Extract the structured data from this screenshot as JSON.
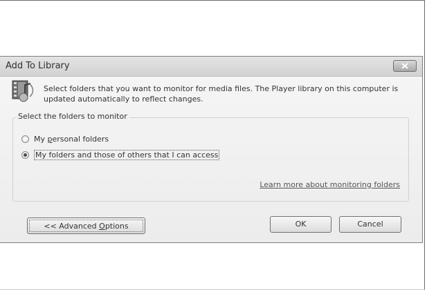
{
  "dialog": {
    "title": "Add To Library",
    "description": "Select folders that you want to monitor for media files. The Player library on this computer is updated automatically to reflect changes.",
    "group_title": "Select the folders to monitor",
    "options": [
      {
        "pre": "My ",
        "access": "p",
        "post": "ersonal folders",
        "checked": false
      },
      {
        "pre": "My folders and those of others that I can access",
        "access": "",
        "post": "",
        "checked": true
      }
    ],
    "learn_more": "Learn more about monitoring folders",
    "buttons": {
      "advanced_pre": "<< Advanced ",
      "advanced_access": "O",
      "advanced_post": "ptions",
      "ok": "OK",
      "cancel": "Cancel"
    }
  },
  "icons": {
    "close": "close-x-icon",
    "media": "media-library-icon"
  }
}
